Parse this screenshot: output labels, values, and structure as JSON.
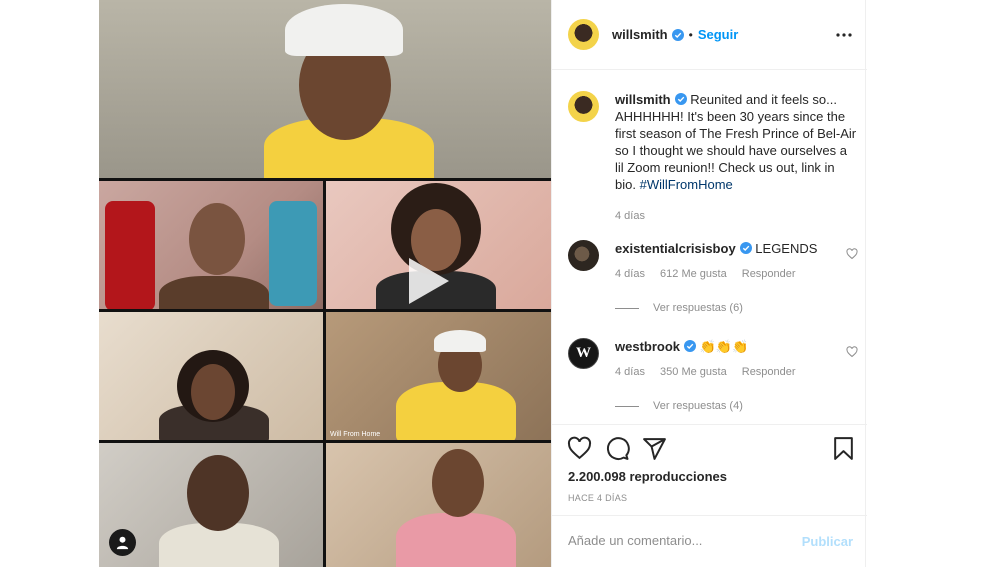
{
  "post": {
    "username": "willsmith",
    "follow_label": "Seguir",
    "separator": "•",
    "caption": "Reunited and it feels so... AHHHHHH! It's been 30 years since the first season of The Fresh Prince of Bel-Air so I thought we should have ourselves a lil Zoom reunion!! Check us out, link in bio.",
    "hashtag": "#WillFromHome",
    "caption_time": "4 días",
    "views": "2.200.098 reproducciones",
    "posted_ago": "HACE 4 DÍAS"
  },
  "media": {
    "tile_label": "Will From Home"
  },
  "comments": [
    {
      "username": "existentialcrisisboy",
      "text": "LEGENDS",
      "time": "4 días",
      "likes": "612 Me gusta",
      "reply_label": "Responder",
      "view_replies": "Ver respuestas (6)"
    },
    {
      "username": "westbrook",
      "text": "👏👏👏",
      "time": "4 días",
      "likes": "350 Me gusta",
      "reply_label": "Responder",
      "view_replies": "Ver respuestas (4)"
    }
  ],
  "comment_box": {
    "placeholder": "Añade un comentario...",
    "publish_label": "Publicar"
  },
  "icons": {
    "verified": "verified-badge-icon",
    "more": "more-options-icon",
    "like": "heart-icon",
    "comment": "comment-icon",
    "share": "share-icon",
    "save": "bookmark-icon",
    "play": "play-icon",
    "tagged": "user-tag-icon"
  },
  "colors": {
    "link_blue": "#0095f6",
    "hashtag": "#00376b",
    "muted": "#8e8e8e",
    "publish_disabled": "#b2dffc"
  }
}
